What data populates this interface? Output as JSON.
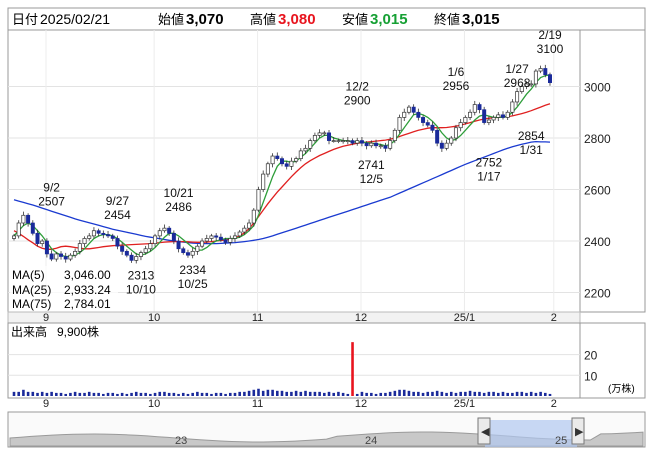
{
  "header": {
    "date_label": "日付",
    "date": "2025/02/21",
    "open_label": "始値",
    "open": "3,070",
    "high_label": "高値",
    "high": "3,080",
    "low_label": "安値",
    "low": "3,015",
    "close_label": "終値",
    "close": "3,015"
  },
  "colors": {
    "high": "#e8141e",
    "low": "#16a034",
    "up_candle": "#ffffff",
    "down_candle": "#1a2a9a",
    "ma5": "#2e9e3a",
    "ma25": "#e02020",
    "ma75": "#1a3ad0",
    "volume": "#1a2a9a",
    "volume_spike": "#e8141e"
  },
  "ma_legend": [
    {
      "label": "MA(5)",
      "value": "3,046.00",
      "color": "#2e9e3a"
    },
    {
      "label": "MA(25)",
      "value": "2,933.24",
      "color": "#e02020"
    },
    {
      "label": "MA(75)",
      "value": "2,784.01",
      "color": "#1a3ad0"
    }
  ],
  "volume_panel": {
    "title": "出来高",
    "value": "9,900株",
    "unit": "(万株)"
  },
  "navigator": {
    "year_labels": [
      "23",
      "24",
      "25"
    ]
  },
  "chart_data": {
    "type": "candlestick",
    "price_axis": {
      "ticks": [
        2200,
        2400,
        2600,
        2800,
        3000
      ],
      "ylim": [
        2140,
        3200
      ]
    },
    "volume_axis": {
      "ticks": [
        10,
        20
      ],
      "ylim": [
        0,
        28
      ]
    },
    "x_ticks": [
      "9",
      "10",
      "11",
      "12",
      "25/1",
      "2"
    ],
    "annotations": [
      {
        "date": "9/2",
        "value": "2507",
        "position": "above"
      },
      {
        "date": "9/27",
        "value": "2454",
        "position": "above"
      },
      {
        "date": "10/10",
        "value": "2313",
        "position": "below"
      },
      {
        "date": "10/21",
        "value": "2486",
        "position": "above"
      },
      {
        "date": "10/25",
        "value": "2334",
        "position": "below"
      },
      {
        "date": "12/2",
        "value": "2900",
        "position": "above"
      },
      {
        "date": "12/5",
        "value": "2741",
        "position": "below"
      },
      {
        "date": "1/6",
        "value": "2956",
        "position": "above"
      },
      {
        "date": "1/17",
        "value": "2752",
        "position": "below"
      },
      {
        "date": "1/27",
        "value": "2968",
        "position": "above"
      },
      {
        "date": "1/31",
        "value": "2854",
        "position": "below"
      },
      {
        "date": "2/19",
        "value": "3100",
        "position": "above"
      }
    ],
    "closes": [
      2420,
      2470,
      2500,
      2470,
      2430,
      2390,
      2400,
      2350,
      2330,
      2350,
      2340,
      2330,
      2345,
      2360,
      2390,
      2410,
      2420,
      2440,
      2430,
      2425,
      2420,
      2410,
      2380,
      2360,
      2345,
      2325,
      2340,
      2355,
      2370,
      2390,
      2420,
      2440,
      2450,
      2430,
      2400,
      2370,
      2355,
      2345,
      2360,
      2380,
      2400,
      2410,
      2420,
      2415,
      2405,
      2395,
      2410,
      2420,
      2435,
      2450,
      2470,
      2520,
      2600,
      2660,
      2700,
      2730,
      2720,
      2700,
      2690,
      2710,
      2720,
      2750,
      2760,
      2790,
      2810,
      2820,
      2820,
      2790,
      2790,
      2790,
      2790,
      2790,
      2780,
      2790,
      2780,
      2770,
      2780,
      2770,
      2770,
      2760,
      2790,
      2830,
      2880,
      2900,
      2920,
      2900,
      2880,
      2860,
      2850,
      2830,
      2780,
      2760,
      2780,
      2800,
      2840,
      2860,
      2880,
      2900,
      2930,
      2910,
      2860,
      2870,
      2880,
      2890,
      2880,
      2900,
      2940,
      2980,
      3000,
      3010,
      3010,
      3060,
      3070,
      3046,
      3015
    ],
    "ma5": [
      2420,
      2440,
      2460,
      2470,
      2460,
      2440,
      2420,
      2395,
      2370,
      2355,
      2345,
      2340,
      2340,
      2345,
      2355,
      2370,
      2390,
      2410,
      2420,
      2425,
      2425,
      2420,
      2410,
      2395,
      2380,
      2365,
      2350,
      2345,
      2350,
      2360,
      2375,
      2395,
      2415,
      2430,
      2430,
      2420,
      2405,
      2390,
      2375,
      2365,
      2365,
      2375,
      2390,
      2400,
      2405,
      2410,
      2410,
      2410,
      2415,
      2425,
      2440,
      2460,
      2500,
      2550,
      2600,
      2650,
      2690,
      2710,
      2710,
      2705,
      2710,
      2725,
      2740,
      2760,
      2780,
      2800,
      2810,
      2810,
      2800,
      2795,
      2790,
      2790,
      2785,
      2785,
      2785,
      2782,
      2780,
      2778,
      2775,
      2770,
      2775,
      2790,
      2815,
      2840,
      2865,
      2890,
      2895,
      2890,
      2880,
      2865,
      2845,
      2820,
      2800,
      2790,
      2795,
      2810,
      2830,
      2850,
      2870,
      2885,
      2890,
      2885,
      2880,
      2880,
      2880,
      2885,
      2900,
      2920,
      2945,
      2970,
      2990,
      3015,
      3035,
      3042,
      3046
    ],
    "ma25": [
      2440,
      2430,
      2418,
      2405,
      2393,
      2380,
      2372,
      2368,
      2368,
      2372,
      2378,
      2380,
      2378,
      2375,
      2372,
      2370,
      2370,
      2372,
      2375,
      2378,
      2380,
      2382,
      2383,
      2384,
      2385,
      2386,
      2387,
      2388,
      2389,
      2390,
      2392,
      2394,
      2396,
      2397,
      2398,
      2398,
      2398,
      2397,
      2396,
      2395,
      2395,
      2396,
      2398,
      2400,
      2402,
      2404,
      2407,
      2412,
      2420,
      2432,
      2448,
      2470,
      2495,
      2520,
      2545,
      2568,
      2590,
      2610,
      2630,
      2650,
      2668,
      2685,
      2700,
      2712,
      2722,
      2732,
      2740,
      2748,
      2756,
      2762,
      2768,
      2772,
      2776,
      2780,
      2782,
      2784,
      2786,
      2788,
      2790,
      2792,
      2795,
      2800,
      2806,
      2812,
      2818,
      2824,
      2830,
      2834,
      2838,
      2840,
      2840,
      2840,
      2841,
      2843,
      2846,
      2850,
      2855,
      2860,
      2865,
      2870,
      2874,
      2877,
      2879,
      2880,
      2881,
      2883,
      2886,
      2890,
      2895,
      2900,
      2906,
      2913,
      2920,
      2927,
      2933
    ],
    "ma75": [
      2560,
      2555,
      2550,
      2545,
      2540,
      2534,
      2528,
      2522,
      2516,
      2510,
      2504,
      2498,
      2492,
      2486,
      2481,
      2476,
      2471,
      2466,
      2461,
      2456,
      2451,
      2446,
      2442,
      2438,
      2434,
      2430,
      2426,
      2422,
      2418,
      2415,
      2412,
      2409,
      2406,
      2403,
      2400,
      2398,
      2396,
      2394,
      2392,
      2391,
      2390,
      2390,
      2390,
      2390,
      2391,
      2392,
      2393,
      2394,
      2396,
      2398,
      2400,
      2403,
      2406,
      2410,
      2415,
      2420,
      2426,
      2432,
      2438,
      2444,
      2450,
      2456,
      2462,
      2468,
      2474,
      2480,
      2486,
      2492,
      2498,
      2504,
      2510,
      2516,
      2522,
      2528,
      2534,
      2540,
      2546,
      2552,
      2558,
      2564,
      2570,
      2578,
      2586,
      2594,
      2602,
      2610,
      2618,
      2626,
      2634,
      2642,
      2650,
      2658,
      2666,
      2674,
      2682,
      2690,
      2698,
      2705,
      2712,
      2719,
      2726,
      2733,
      2740,
      2747,
      2754,
      2760,
      2766,
      2771,
      2776,
      2780,
      2784,
      2786,
      2785,
      2785,
      2784
    ],
    "volumes": [
      2,
      2,
      3,
      2,
      2,
      1.5,
      2,
      1.5,
      2,
      1.5,
      1.5,
      1,
      1.5,
      2,
      1.5,
      1.5,
      2,
      1.5,
      1.5,
      1,
      1.5,
      1.5,
      1,
      1.5,
      1,
      1.5,
      2,
      1.5,
      1.5,
      1,
      1.5,
      2,
      2,
      1.5,
      1.5,
      1,
      1.5,
      1,
      1.5,
      2,
      1.5,
      1.5,
      1,
      1.5,
      1.5,
      1,
      1.5,
      1.5,
      2,
      2,
      2.5,
      3,
      3.5,
      2.5,
      3,
      3,
      2.5,
      2.5,
      2,
      2,
      2.5,
      2,
      2.5,
      2,
      2,
      2,
      1.5,
      2,
      1.5,
      2,
      1.5,
      1,
      1.5,
      1,
      2,
      1.5,
      1.5,
      1,
      1.5,
      1.5,
      2,
      2.5,
      3,
      3,
      2.5,
      2,
      2,
      1.5,
      2,
      2,
      2.5,
      2,
      1.5,
      2,
      1.5,
      2,
      2,
      2.5,
      2,
      2,
      1.5,
      2,
      2,
      1.5,
      2,
      1.5,
      1.5,
      2,
      2,
      1.5,
      2,
      1.5,
      2,
      1.5,
      1
    ],
    "volume_spike": {
      "index": 72,
      "value": 26
    }
  }
}
